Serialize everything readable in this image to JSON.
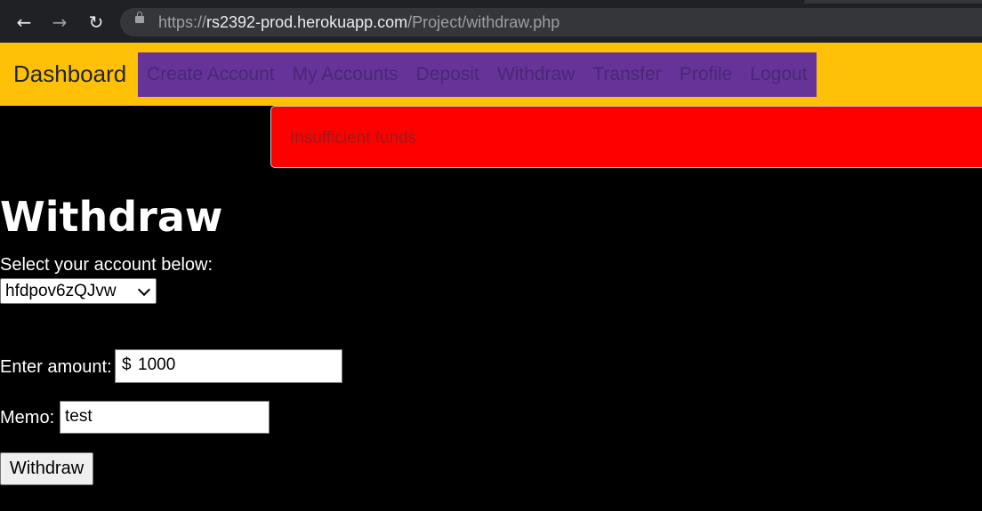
{
  "browser": {
    "url_scheme": "https://",
    "url_host": "rs2392-prod.herokuapp.com",
    "url_path": "/Project/withdraw.php"
  },
  "navbar": {
    "brand": "Dashboard",
    "links": [
      "Create Account",
      "My Accounts",
      "Deposit",
      "Withdraw",
      "Transfer",
      "Profile",
      "Logout"
    ]
  },
  "alert": {
    "message": "Insufficient funds",
    "color": "#ff0000"
  },
  "page": {
    "title": "Withdraw",
    "select_label": "Select your account below:",
    "selected_account": "hfdpov6zQJvw",
    "amount_label": "Enter amount:",
    "currency_symbol": "$",
    "amount_value": "1000",
    "memo_label": "Memo:",
    "memo_value": "test",
    "submit_label": "Withdraw"
  },
  "colors": {
    "navbar": "#ffc107",
    "nav_links_bg": "#663399",
    "background": "#000000"
  }
}
